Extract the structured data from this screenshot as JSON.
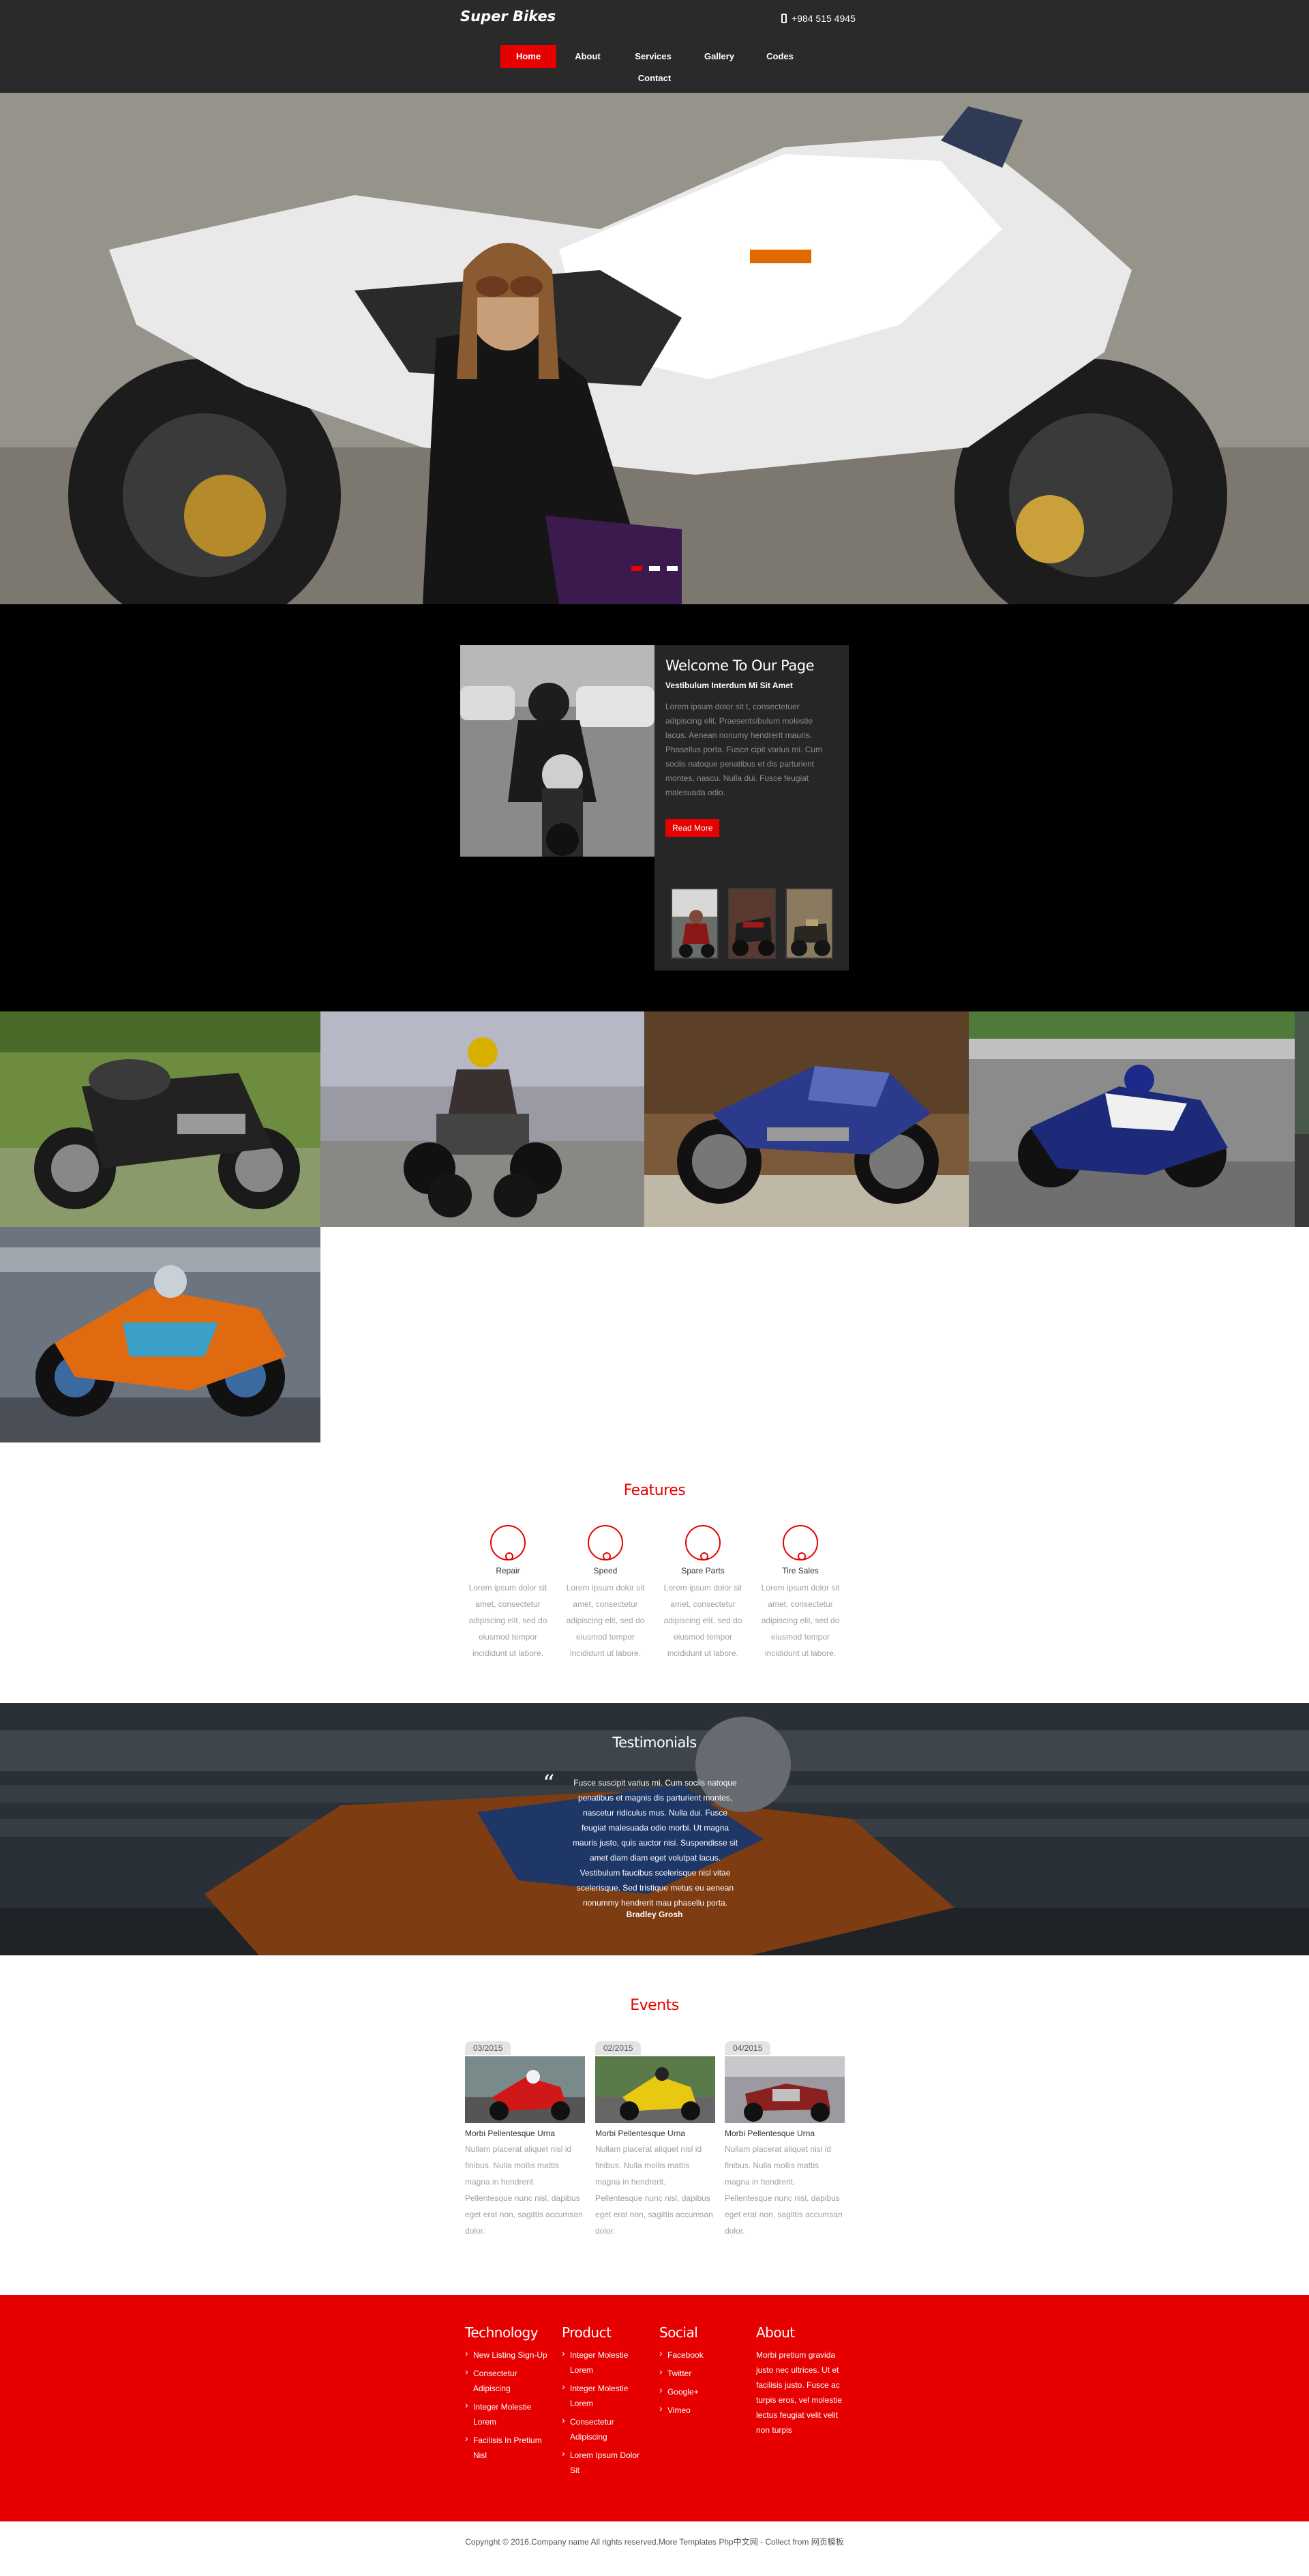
{
  "header": {
    "logo": "Super Bikes",
    "phone": "+984 515 4945",
    "nav": [
      {
        "label": "Home",
        "active": true
      },
      {
        "label": "About"
      },
      {
        "label": "Services"
      },
      {
        "label": "Gallery"
      },
      {
        "label": "Codes"
      },
      {
        "label": "Contact"
      }
    ]
  },
  "hero": {
    "slides": 3,
    "active_slide": 1
  },
  "welcome": {
    "title": "Welcome To Our Page",
    "subtitle": "Vestibulum Interdum Mi Sit Amet",
    "text": "Lorem ipsum dolor sit t, consectetuer adipiscing elit. Praesentsibulum molestie lacus. Aenean nonumy hendrerit mauris. Phasellus porta. Fusce cipit varius mi. Cum sociis natoque penatibus et dis parturient montes, nascu. Nulla dui. Fusce feugiat malesuada odio.",
    "button": "Read More"
  },
  "features": {
    "title": "Features",
    "items": [
      {
        "name": "Repair",
        "text": "Lorem ipsum dolor sit amet, consectetur adipiscing elit, sed do eiusmod tempor incididunt ut labore."
      },
      {
        "name": "Speed",
        "text": "Lorem ipsum dolor sit amet, consectetur adipiscing elit, sed do eiusmod tempor incididunt ut labore."
      },
      {
        "name": "Spare Parts",
        "text": "Lorem ipsum dolor sit amet, consectetur adipiscing elit, sed do eiusmod tempor incididunt ut labore."
      },
      {
        "name": "Tire Sales",
        "text": "Lorem ipsum dolor sit amet, consectetur adipiscing elit, sed do eiusmod tempor incididunt ut labore."
      }
    ]
  },
  "testimonials": {
    "title": "Testimonials",
    "quote": "Fusce suscipit varius mi. Cum sociis natoque penatibus et magnis dis parturient montes, nascetur ridiculus mus. Nulla dui. Fusce feugiat malesuada odio morbi. Ut magna mauris justo, quis auctor nisi. Suspendisse sit amet diam diam eget volutpat lacus. Vestibulum faucibus scelerisque nisl vitae scelerisque. Sed tristique metus eu aenean nonummy hendrerit mau phasellu porta.",
    "author": "Bradley Grosh"
  },
  "events": {
    "title": "Events",
    "items": [
      {
        "date": "03/2015",
        "title": "Morbi Pellentesque Urna",
        "text": "Nullam placerat aliquet nisl id finibus. Nulla mollis mattis magna in hendrerit. Pellentesque nunc nisl, dapibus eget erat non, sagittis accumsan dolor."
      },
      {
        "date": "02/2015",
        "title": "Morbi Pellentesque Urna",
        "text": "Nullam placerat aliquet nisl id finibus. Nulla mollis mattis magna in hendrerit. Pellentesque nunc nisl, dapibus eget erat non, sagittis accumsan dolor."
      },
      {
        "date": "04/2015",
        "title": "Morbi Pellentesque Urna",
        "text": "Nullam placerat aliquet nisl id finibus. Nulla mollis mattis magna in hendrerit. Pellentesque nunc nisl, dapibus eget erat non, sagittis accumsan dolor."
      }
    ]
  },
  "footer": {
    "technology": {
      "title": "Technology",
      "items": [
        "New Listing Sign-Up",
        "Consectetur Adipiscing",
        "Integer Molestie Lorem",
        "Facilisis In Pretium Nisl"
      ]
    },
    "product": {
      "title": "Product",
      "items": [
        "Integer Molestie Lorem",
        "Integer Molestie Lorem",
        "Consectetur Adipiscing",
        "Lorem Ipsum Dolor Sit"
      ]
    },
    "social": {
      "title": "Social",
      "items": [
        "Facebook",
        "Twitter",
        "Google+",
        "Vimeo"
      ]
    },
    "about": {
      "title": "About",
      "text": "Morbi pretium gravida justo nec ultrices. Ut et facilisis justo. Fusce ac turpis eros, vel molestie lectus feugiat velit velit non turpis"
    }
  },
  "copyright": "Copyright © 2016.Company name All rights reserved.More Templates Php中文网 - Collect from 网页模板",
  "colors": {
    "accent": "#e60000",
    "header_bg": "#2a2a2a",
    "welcome_bg": "#000000",
    "box_bg": "#262626"
  }
}
